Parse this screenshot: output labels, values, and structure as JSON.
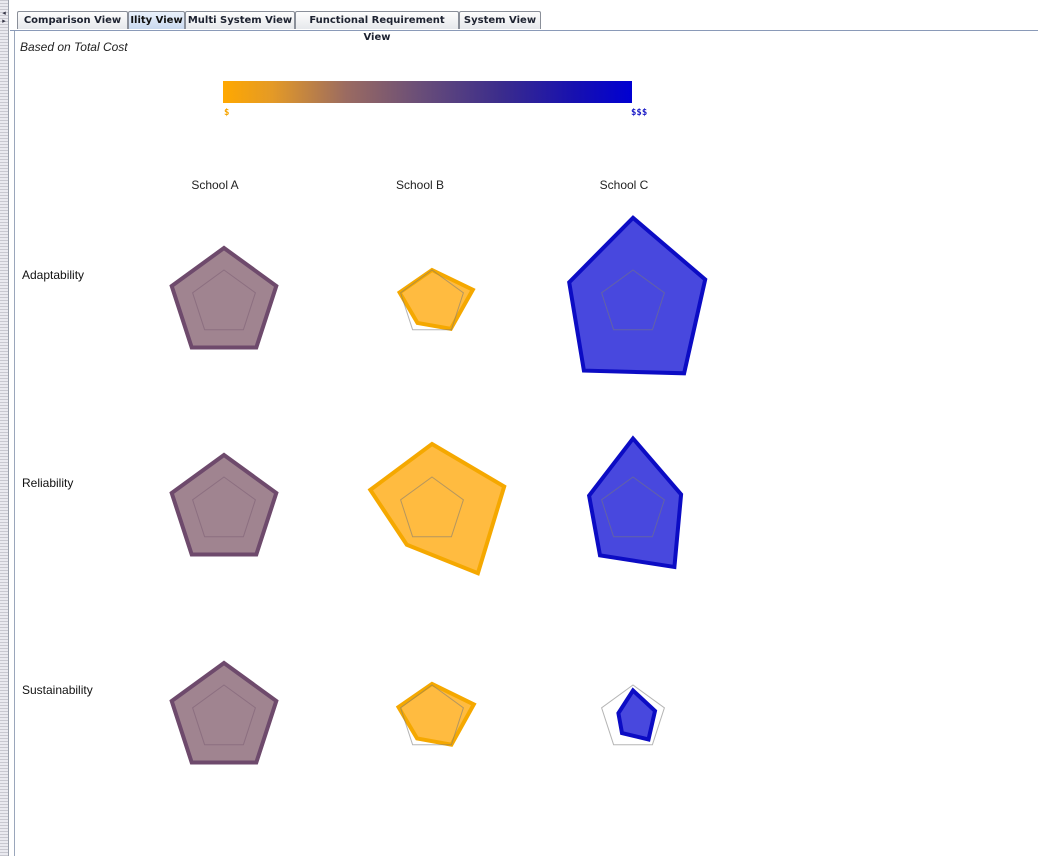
{
  "tabs": [
    {
      "label": "Comparison View",
      "active": false
    },
    {
      "label": "Ility View",
      "active": true
    },
    {
      "label": "Multi System View",
      "active": false
    },
    {
      "label": "Functional Requirement View",
      "active": false
    },
    {
      "label": "System View",
      "active": false
    }
  ],
  "caption": "Based on Total Cost",
  "legend": {
    "low_label": "$",
    "high_label": "$$$",
    "low_color": "#ffa800",
    "high_color": "#0000d2"
  },
  "columns": [
    "School A",
    "School B",
    "School C"
  ],
  "rows": [
    "Adaptability",
    "Reliability",
    "Sustainability"
  ],
  "colors": {
    "school_a": {
      "fill": "#a08490",
      "stroke": "#6e4a6c"
    },
    "school_b": {
      "fill": "#ffbb40",
      "stroke": "#f5a800"
    },
    "school_c": {
      "fill": "#4848de",
      "stroke": "#0c0cc4"
    }
  },
  "chart_data": {
    "type": "radar",
    "axes_per_glyph": 5,
    "reference_shape_shown": true,
    "glyphs": [
      {
        "row": "Adaptability",
        "column": "School A",
        "values": [
          1,
          1,
          1,
          1,
          1
        ]
      },
      {
        "row": "Adaptability",
        "column": "School B",
        "values": [
          0.6,
          0.78,
          0.58,
          0.45,
          0.62
        ]
      },
      {
        "row": "Adaptability",
        "column": "School C",
        "values": [
          1.55,
          1.38,
          1.58,
          1.52,
          1.22
        ]
      },
      {
        "row": "Reliability",
        "column": "School A",
        "values": [
          1,
          1,
          1,
          1,
          1
        ]
      },
      {
        "row": "Reliability",
        "column": "School B",
        "values": [
          1.2,
          1.38,
          1.42,
          0.78,
          1.18
        ]
      },
      {
        "row": "Reliability",
        "column": "School C",
        "values": [
          1.3,
          0.92,
          1.28,
          1.02,
          0.84
        ]
      },
      {
        "row": "Sustainability",
        "column": "School A",
        "values": [
          1,
          1,
          1,
          1,
          1
        ]
      },
      {
        "row": "Sustainability",
        "column": "School B",
        "values": [
          0.62,
          0.8,
          0.6,
          0.46,
          0.64
        ]
      },
      {
        "row": "Sustainability",
        "column": "School C",
        "values": [
          0.5,
          0.42,
          0.48,
          0.34,
          0.28
        ]
      }
    ]
  }
}
